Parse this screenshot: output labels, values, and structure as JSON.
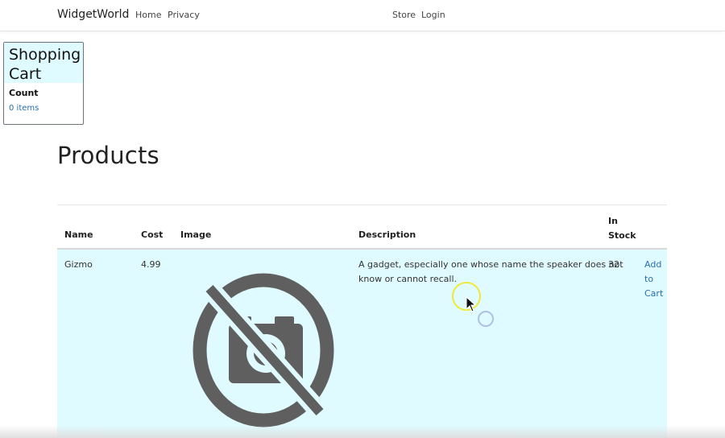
{
  "navbar": {
    "brand": "WidgetWorld",
    "left_links": [
      "Home",
      "Privacy"
    ],
    "right_links": [
      "Store",
      "Login"
    ]
  },
  "cart": {
    "title_line1": "Shopping",
    "title_line2": "Cart",
    "count_label": "Count",
    "count_value": "0 items"
  },
  "page_title": "Products",
  "table": {
    "headers": {
      "name": "Name",
      "cost": "Cost",
      "image": "Image",
      "description": "Description",
      "stock_line1": "In",
      "stock_line2": "Stock"
    },
    "rows": [
      {
        "name": "Gizmo",
        "cost": "4.99",
        "image_icon": "no-image-icon",
        "description_line1": "A gadget, especially one whose name the speaker does not",
        "description_line2": "know or cannot recall.",
        "stock": "32",
        "action_line1": "Add",
        "action_line2": "to",
        "action_line3": "Cart"
      }
    ]
  },
  "colors": {
    "highlight_row": "#e0fbff",
    "link": "#2a6fb0",
    "cursor_ring": "#f0ea37"
  }
}
